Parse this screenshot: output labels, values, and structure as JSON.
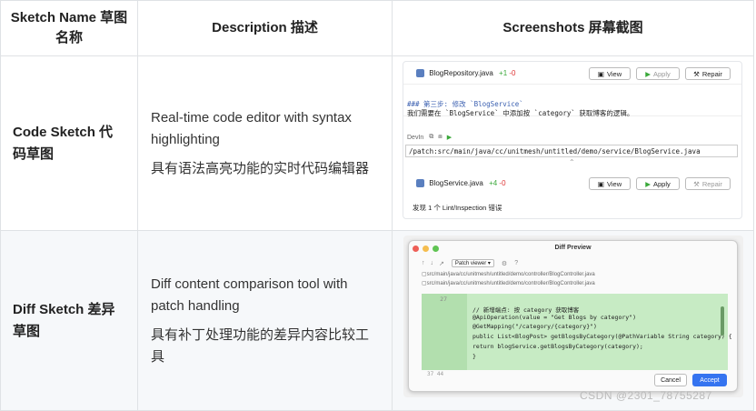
{
  "table": {
    "headers": [
      "Sketch Name 草图名称",
      "Description 描述",
      "Screenshots 屏幕截图"
    ],
    "rows": [
      {
        "name": "Code Sketch 代码草图",
        "desc_en": "Real-time code editor with syntax highlighting",
        "desc_zh": "具有语法高亮功能的实时代码编辑器"
      },
      {
        "name": "Diff Sketch 差异草图",
        "desc_en": "Diff content comparison tool with patch handling",
        "desc_zh": "具有补丁处理功能的差异内容比较工具"
      }
    ]
  },
  "code_sketch": {
    "file1": "BlogRepository.java",
    "file1_add": "+1",
    "file1_del": "-0",
    "view": "View",
    "apply": "Apply",
    "repair": "Repair",
    "step_heading": "### 第三步: 修改 `BlogService`",
    "step_text": "我们需要在 `BlogService` 中添加按 `category` 获取博客的逻辑。",
    "devin_label": "DevIn",
    "patch_path": "/patch:src/main/java/cc/unitmesh/untitled/demo/service/BlogService.java",
    "file2": "BlogService.java",
    "file2_add": "+4",
    "file2_del": "-0",
    "lint_text": "发现 1 个 Lint/Inspection 错误"
  },
  "diff_sketch": {
    "title": "Diff Preview",
    "viewer": "Patch viewer",
    "path1": "src/main/java/cc/unitmesh/untitled/demo/controller/BlogController.java",
    "path2": "src/main/java/cc/unitmesh/untitled/demo/controller/BlogController.java",
    "line_numbers": [
      "27",
      "",
      "",
      "",
      "",
      "",
      "",
      "",
      "",
      "37 44"
    ],
    "code_lines": [
      "// 新增端点: 按 category 获取博客",
      "@ApiOperation(value = \"Get Blogs by category\")",
      "@GetMapping(\"/category/{category}\")",
      "public List<BlogPost> getBlogsByCategory(@PathVariable String category) {",
      "    return blogService.getBlogsByCategory(category);",
      "}"
    ],
    "cancel": "Cancel",
    "accept": "Accept"
  },
  "watermark": "CSDN @2301_78755287"
}
